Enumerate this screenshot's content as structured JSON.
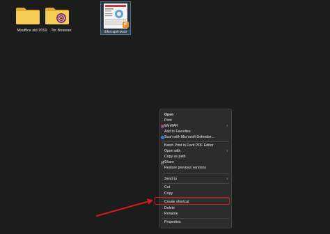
{
  "desktop": {
    "icons": [
      {
        "label": "Msoffice std 2019",
        "icon": "folder-icon"
      },
      {
        "label": "Tor Browser",
        "icon": "folder-tor-icon"
      },
      {
        "label": "ibf04-april-2023",
        "icon": "pdf-thumbnail-icon"
      }
    ]
  },
  "context_menu": {
    "items": [
      {
        "label": "Open"
      },
      {
        "label": "Print"
      },
      {
        "label": "WinRAR",
        "icon": "winrar-icon"
      },
      {
        "label": "Add to Favorites"
      },
      {
        "label": "Scan with Microsoft Defender...",
        "icon": "defender-shield-icon"
      },
      {
        "label": "Batch Print in Foxit PDF Editor"
      },
      {
        "label": "Open with"
      },
      {
        "label": "Copy as path"
      },
      {
        "label": "Share",
        "icon": "share-icon"
      },
      {
        "label": "Restore previous versions"
      },
      {
        "label": "Send to"
      },
      {
        "label": "Cut"
      },
      {
        "label": "Copy"
      },
      {
        "label": "Create shortcut"
      },
      {
        "label": "Delete"
      },
      {
        "label": "Rename"
      },
      {
        "label": "Properties"
      }
    ],
    "highlighted_item": "Create shortcut"
  },
  "annotation": {
    "color": "#d71a1a"
  },
  "colors": {
    "background": "#1c1c1c",
    "menu_background": "#2c2c2c",
    "folder_yellow": "#f2c94c",
    "tor_purple": "#7a2d8f"
  }
}
